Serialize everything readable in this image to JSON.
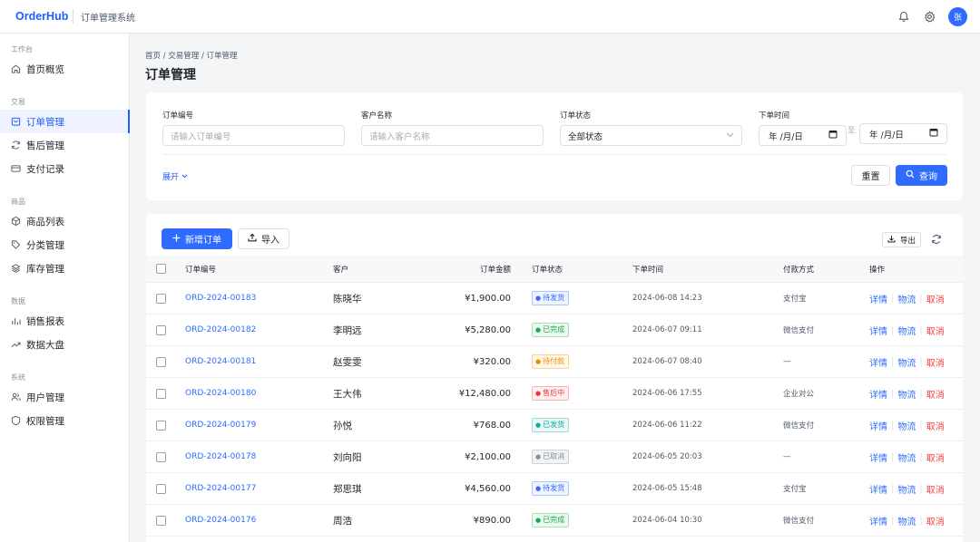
{
  "app": {
    "brand": "OrderHub",
    "system_title": "订单管理系统",
    "avatar_text": "张"
  },
  "sidebar": {
    "groups": [
      {
        "label": "工作台",
        "items": [
          {
            "label": "首页概览",
            "icon": "home-icon"
          }
        ]
      },
      {
        "label": "交易",
        "items": [
          {
            "label": "订单管理",
            "icon": "bag-icon",
            "active": true
          },
          {
            "label": "售后管理",
            "icon": "refresh-icon"
          },
          {
            "label": "支付记录",
            "icon": "card-icon"
          }
        ]
      },
      {
        "label": "商品",
        "items": [
          {
            "label": "商品列表",
            "icon": "cube-icon"
          },
          {
            "label": "分类管理",
            "icon": "tag-icon"
          },
          {
            "label": "库存管理",
            "icon": "layers-icon"
          }
        ]
      },
      {
        "label": "数据",
        "items": [
          {
            "label": "销售报表",
            "icon": "bar-chart-icon"
          },
          {
            "label": "数据大盘",
            "icon": "trend-icon"
          }
        ]
      },
      {
        "label": "系统",
        "items": [
          {
            "label": "用户管理",
            "icon": "users-icon"
          },
          {
            "label": "权限管理",
            "icon": "shield-icon"
          }
        ]
      }
    ]
  },
  "breadcrumb": "首页 / 交易管理 / 订单管理",
  "page_title": "订单管理",
  "filters": {
    "order_no": {
      "label": "订单编号",
      "placeholder": "请输入订单编号"
    },
    "customer": {
      "label": "客户名称",
      "placeholder": "请输入客户名称"
    },
    "status": {
      "label": "订单状态",
      "value": "全部状态"
    },
    "date": {
      "label": "下单时间",
      "start": "年 /月/日",
      "sep": "至",
      "end": "年 /月/日"
    },
    "expand": "展开",
    "reset": "重置",
    "query": "查询"
  },
  "toolbar": {
    "add": "新增订单",
    "import": "导入",
    "export": "导出"
  },
  "table": {
    "columns": {
      "no": "订单编号",
      "customer": "客户",
      "amount": "订单金额",
      "status": "订单状态",
      "time": "下单时间",
      "pay": "付款方式",
      "ops": "操作"
    },
    "ops": {
      "detail": "详情",
      "logistics": "物流",
      "cancel": "取消"
    },
    "rows": [
      {
        "no": "ORD-2024-00183",
        "customer": "陈晓华",
        "amount": "¥1,900.00",
        "status": "待发货",
        "status_color": "#2f6bff",
        "status_bg": "#eef3ff",
        "time": "2024-06-08 14:23",
        "pay": "支付宝"
      },
      {
        "no": "ORD-2024-00182",
        "customer": "李明远",
        "amount": "¥5,280.00",
        "status": "已完成",
        "status_color": "#1ea84a",
        "status_bg": "#edf9f0",
        "time": "2024-06-07 09:11",
        "pay": "微信支付"
      },
      {
        "no": "ORD-2024-00181",
        "customer": "赵雯雯",
        "amount": "¥320.00",
        "status": "待付款",
        "status_color": "#f08c00",
        "status_bg": "#fff6e8",
        "time": "2024-06-07 08:40",
        "pay": "—"
      },
      {
        "no": "ORD-2024-00180",
        "customer": "王大伟",
        "amount": "¥12,480.00",
        "status": "售后中",
        "status_color": "#e5383b",
        "status_bg": "#fff0f0",
        "time": "2024-06-06 17:55",
        "pay": "企业对公"
      },
      {
        "no": "ORD-2024-00179",
        "customer": "孙悦",
        "amount": "¥768.00",
        "status": "已发货",
        "status_color": "#14a8a0",
        "status_bg": "#e8f8f7",
        "time": "2024-06-06 11:22",
        "pay": "微信支付"
      },
      {
        "no": "ORD-2024-00178",
        "customer": "刘向阳",
        "amount": "¥2,100.00",
        "status": "已取消",
        "status_color": "#86909c",
        "status_bg": "#f2f3f5",
        "time": "2024-06-05 20:03",
        "pay": "—"
      },
      {
        "no": "ORD-2024-00177",
        "customer": "郑思琪",
        "amount": "¥4,560.00",
        "status": "待发货",
        "status_color": "#2f6bff",
        "status_bg": "#eef3ff",
        "time": "2024-06-05 15:48",
        "pay": "支付宝"
      },
      {
        "no": "ORD-2024-00176",
        "customer": "周浩",
        "amount": "¥890.00",
        "status": "已完成",
        "status_color": "#1ea84a",
        "status_bg": "#edf9f0",
        "time": "2024-06-04 10:30",
        "pay": "微信支付"
      }
    ]
  }
}
